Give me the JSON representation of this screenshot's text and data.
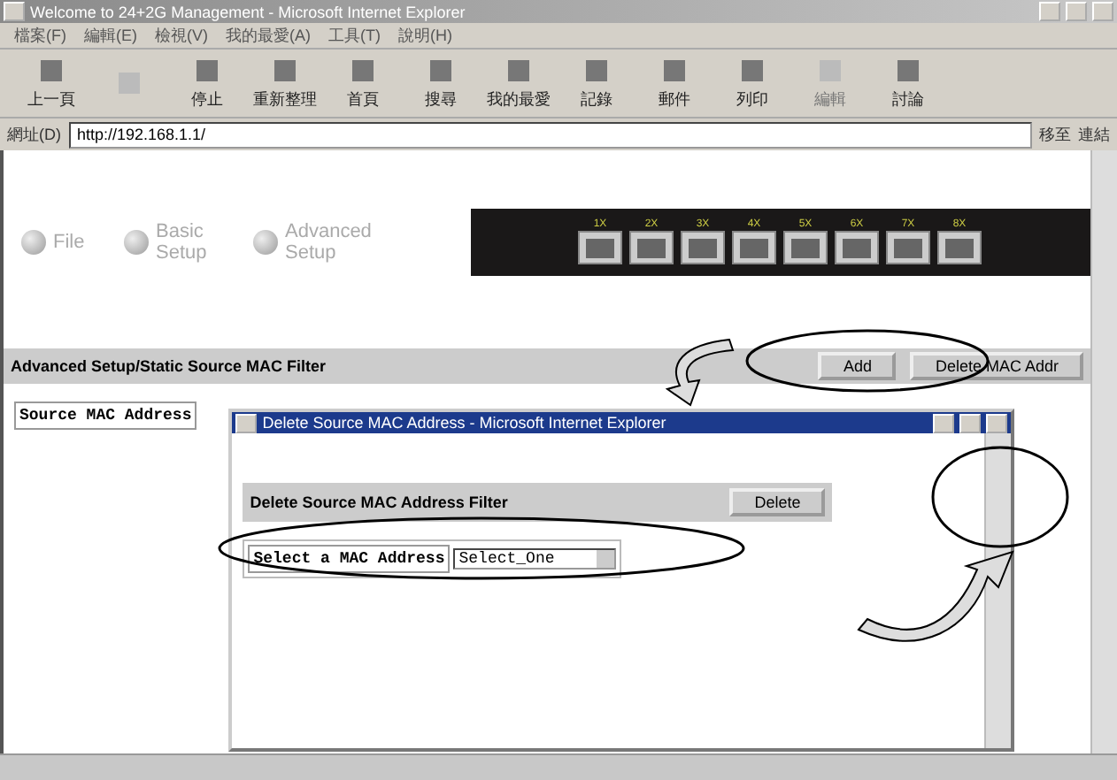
{
  "window": {
    "title": "Welcome to 24+2G Management - Microsoft Internet Explorer"
  },
  "menu": [
    "檔案(F)",
    "編輯(E)",
    "檢視(V)",
    "我的最愛(A)",
    "工具(T)",
    "說明(H)"
  ],
  "toolbar": [
    {
      "label": "上一頁",
      "disabled": false
    },
    {
      "disabled": true
    },
    {
      "label": "停止",
      "disabled": false
    },
    {
      "label": "重新整理",
      "disabled": false
    },
    {
      "label": "首頁",
      "disabled": false
    },
    {
      "label": "搜尋",
      "disabled": false
    },
    {
      "label": "我的最愛",
      "disabled": false
    },
    {
      "label": "記錄",
      "disabled": false
    },
    {
      "label": "郵件",
      "disabled": false
    },
    {
      "label": "列印",
      "disabled": false
    },
    {
      "label": "編輯",
      "disabled": true
    },
    {
      "label": "討論",
      "disabled": false
    }
  ],
  "address": {
    "label": "網址(D)",
    "value": "http://192.168.1.1/",
    "go": "移至",
    "links": "連結"
  },
  "nav": [
    {
      "label": "File"
    },
    {
      "label": "Basic Setup"
    },
    {
      "label": "Advanced Setup"
    }
  ],
  "switch": {
    "port_labels": [
      "1X",
      "2X",
      "3X",
      "4X",
      "5X",
      "6X",
      "7X",
      "8X"
    ]
  },
  "header": {
    "title": "Advanced Setup/Static Source MAC Filter",
    "buttons": [
      "Add",
      "Delete MAC Addr"
    ]
  },
  "table": {
    "column_1": "Source MAC Address"
  },
  "popup": {
    "title": "Delete Source MAC Address - Microsoft Internet Explorer",
    "heading": "Delete Source MAC Address Filter",
    "button": "Delete",
    "field_label": "Select a MAC Address",
    "select_value": "Select_One"
  }
}
